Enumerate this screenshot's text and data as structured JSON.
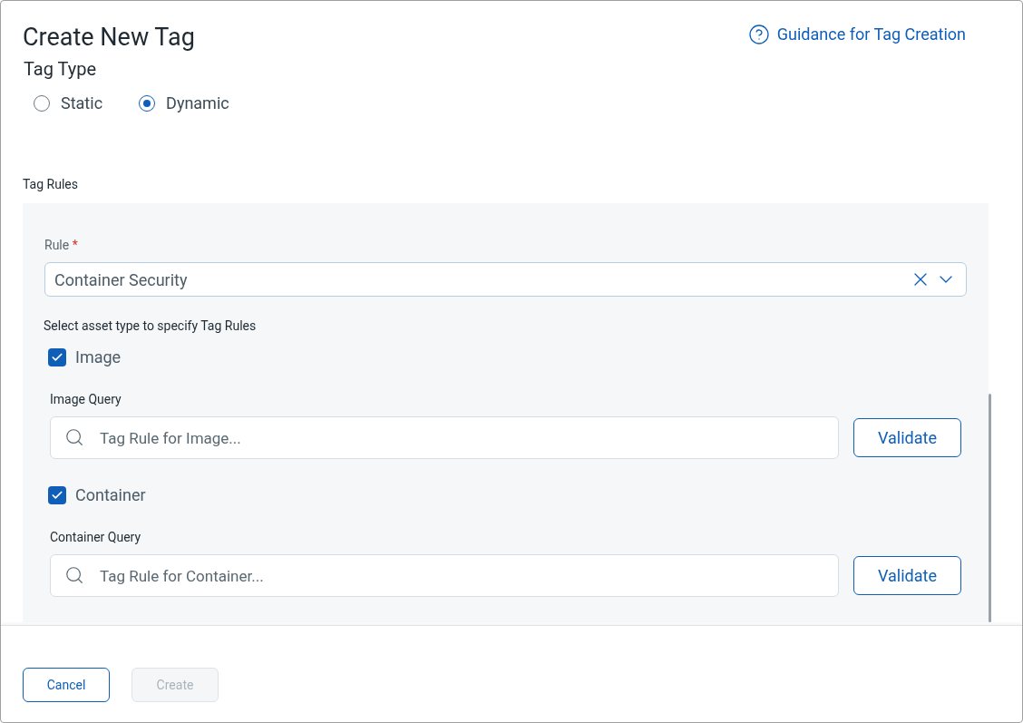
{
  "dialog": {
    "title": "Create New Tag",
    "help_link": "Guidance for Tag Creation"
  },
  "tag_type": {
    "label": "Tag Type",
    "options": [
      {
        "label": "Static",
        "selected": false
      },
      {
        "label": "Dynamic",
        "selected": true
      }
    ]
  },
  "tag_rules": {
    "label": "Tag Rules",
    "rule": {
      "label": "Rule",
      "required_mark": "*",
      "value": "Container Security"
    },
    "asset_prompt": "Select asset type to specify Tag Rules",
    "assets": [
      {
        "label": "Image",
        "checked": true,
        "query_label": "Image Query",
        "placeholder": "Tag Rule for Image...",
        "button": "Validate"
      },
      {
        "label": "Container",
        "checked": true,
        "query_label": "Container Query",
        "placeholder": "Tag Rule for Container...",
        "button": "Validate"
      }
    ]
  },
  "footer": {
    "buttons": [
      {
        "label": "Cancel",
        "disabled": false
      },
      {
        "label": "Create",
        "disabled": true
      }
    ]
  }
}
